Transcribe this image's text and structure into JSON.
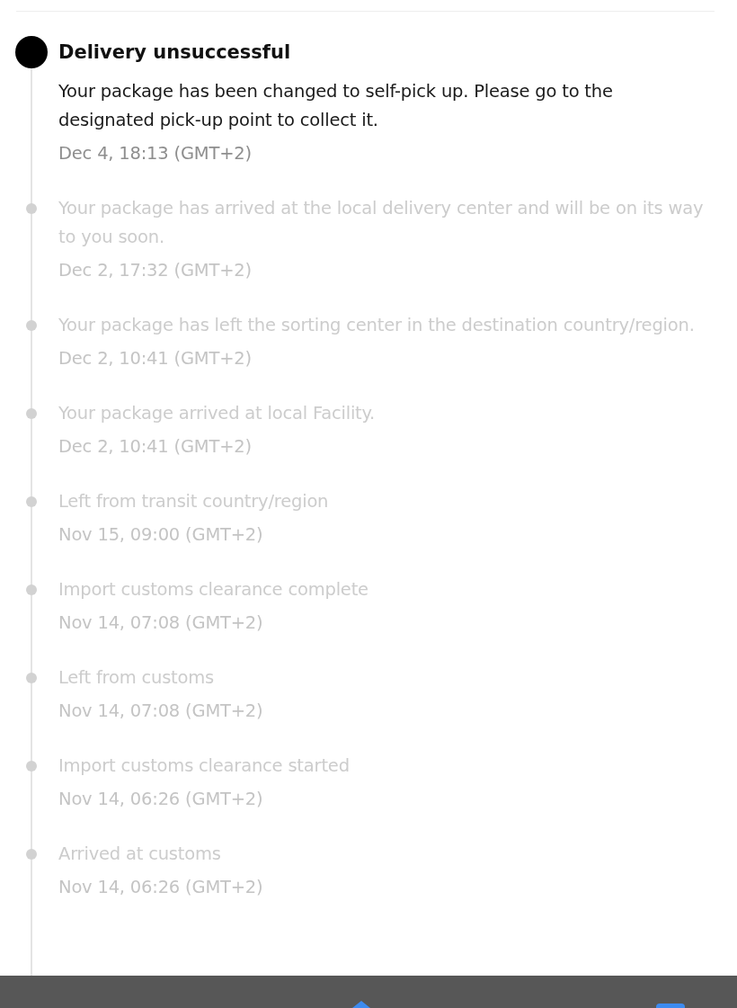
{
  "events": [
    {
      "current": true,
      "title": "Delivery unsuccessful",
      "description": "Your package has been changed to self-pick up. Please go to the designated pick-up point to collect it.",
      "time": "Dec 4, 18:13 (GMT+2)"
    },
    {
      "current": false,
      "description": "Your package has arrived at the local delivery center and will be on its way to you soon.",
      "time": "Dec 2, 17:32 (GMT+2)"
    },
    {
      "current": false,
      "description": "Your package has left the sorting center in the destination country/region.",
      "time": "Dec 2, 10:41 (GMT+2)"
    },
    {
      "current": false,
      "description": "Your package arrived at local Facility.",
      "time": "Dec 2, 10:41 (GMT+2)"
    },
    {
      "current": false,
      "description": "Left from transit country/region",
      "time": "Nov 15, 09:00 (GMT+2)"
    },
    {
      "current": false,
      "description": "Import customs clearance complete",
      "time": "Nov 14, 07:08 (GMT+2)"
    },
    {
      "current": false,
      "description": "Left from customs",
      "time": "Nov 14, 07:08 (GMT+2)"
    },
    {
      "current": false,
      "description": "Import customs clearance started",
      "time": "Nov 14, 06:26 (GMT+2)"
    },
    {
      "current": false,
      "description": "Arrived at customs",
      "time": "Nov 14, 06:26 (GMT+2)"
    }
  ]
}
